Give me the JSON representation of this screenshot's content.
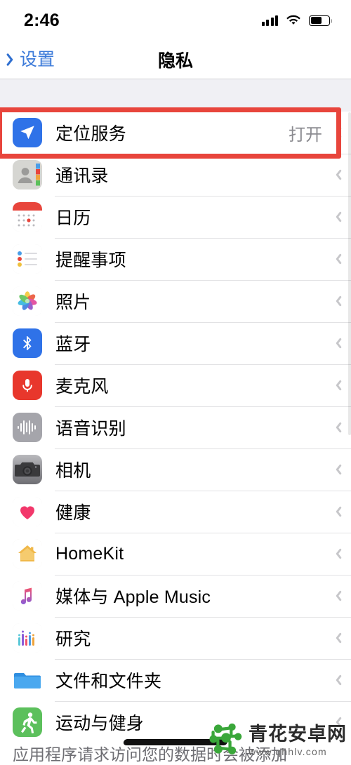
{
  "status_bar": {
    "time": "2:46",
    "signal_icon": "cellular-signal-icon",
    "wifi_icon": "wifi-icon",
    "battery_icon": "battery-icon",
    "battery_level_percent": 62
  },
  "nav_bar": {
    "back_label": "设置",
    "back_icon": "chevron-left-icon",
    "title": "隐私"
  },
  "list": {
    "rows": [
      {
        "label": "定位服务",
        "value": "打开",
        "icon": "location-services-icon",
        "highlighted": true
      },
      {
        "label": "通讯录",
        "value": "",
        "icon": "contacts-icon"
      },
      {
        "label": "日历",
        "value": "",
        "icon": "calendar-icon"
      },
      {
        "label": "提醒事项",
        "value": "",
        "icon": "reminders-icon"
      },
      {
        "label": "照片",
        "value": "",
        "icon": "photos-icon"
      },
      {
        "label": "蓝牙",
        "value": "",
        "icon": "bluetooth-icon"
      },
      {
        "label": "麦克风",
        "value": "",
        "icon": "microphone-icon"
      },
      {
        "label": "语音识别",
        "value": "",
        "icon": "speech-recognition-icon"
      },
      {
        "label": "相机",
        "value": "",
        "icon": "camera-icon"
      },
      {
        "label": "健康",
        "value": "",
        "icon": "health-icon"
      },
      {
        "label": "HomeKit",
        "value": "",
        "icon": "homekit-icon"
      },
      {
        "label": "媒体与 Apple Music",
        "value": "",
        "icon": "apple-music-icon"
      },
      {
        "label": "研究",
        "value": "",
        "icon": "research-icon"
      },
      {
        "label": "文件和文件夹",
        "value": "",
        "icon": "files-and-folders-icon"
      },
      {
        "label": "运动与健身",
        "value": "",
        "icon": "motion-fitness-icon"
      }
    ]
  },
  "footer": {
    "text": "应用程序请求访问您的数据时会被添加"
  },
  "annotation": {
    "color": "#e8453c",
    "target": "定位服务"
  },
  "watermark": {
    "name": "青花安卓网",
    "url": "www.qhhlv.com",
    "logo_icon": "molecule-logo-icon",
    "color": "#3aa73a"
  }
}
